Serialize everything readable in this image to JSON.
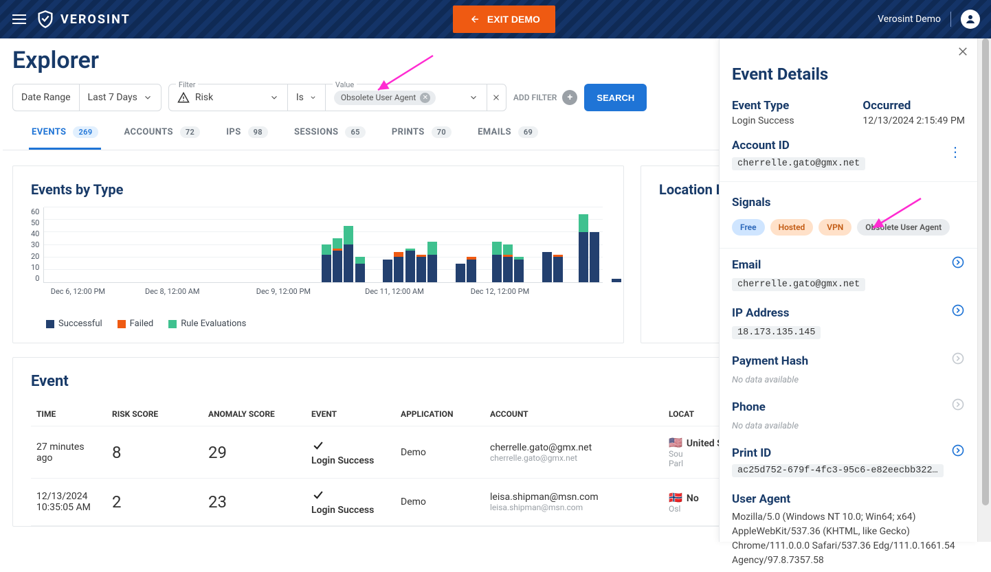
{
  "header": {
    "brand": "VEROSINT",
    "exit_demo_label": "EXIT DEMO",
    "account_label": "Verosint Demo"
  },
  "page_title": "Explorer",
  "filters": {
    "date_range_label": "Date Range",
    "date_range_value": "Last 7 Days",
    "filter_label": "Filter",
    "filter_value": "Risk",
    "operator_label": "Is",
    "value_label": "Value",
    "value_chip": "Obsolete User Agent",
    "add_filter_label": "ADD FILTER",
    "search_label": "SEARCH"
  },
  "tabs": [
    {
      "label": "EVENTS",
      "count": "269",
      "active": true
    },
    {
      "label": "ACCOUNTS",
      "count": "72",
      "active": false
    },
    {
      "label": "IPS",
      "count": "98",
      "active": false
    },
    {
      "label": "SESSIONS",
      "count": "65",
      "active": false
    },
    {
      "label": "PRINTS",
      "count": "70",
      "active": false
    },
    {
      "label": "EMAILS",
      "count": "69",
      "active": false
    }
  ],
  "events_by_type_title": "Events by Type",
  "location_card_title_partial": "Location B",
  "legend": {
    "successful": "Successful",
    "failed": "Failed",
    "rule": "Rule Evaluations"
  },
  "chart_data": {
    "type": "bar",
    "ylim": [
      0,
      60
    ],
    "y_ticks": [
      0,
      10,
      20,
      30,
      40,
      50,
      60
    ],
    "ylabel": "",
    "x_ticks": [
      {
        "pos": 0.05,
        "label": "Dec 6, 12:00 PM"
      },
      {
        "pos": 0.22,
        "label": "Dec 8, 12:00 AM"
      },
      {
        "pos": 0.42,
        "label": "Dec 9, 12:00 PM"
      },
      {
        "pos": 0.62,
        "label": "Dec 11, 12:00 AM"
      },
      {
        "pos": 0.81,
        "label": "Dec 12, 12:00 PM"
      }
    ],
    "series_names": [
      "Successful",
      "Failed",
      "Rule Evaluations"
    ],
    "bars": [
      {
        "x": 0.505,
        "values": [
          22,
          0,
          8
        ]
      },
      {
        "x": 0.525,
        "values": [
          25,
          2,
          8
        ]
      },
      {
        "x": 0.545,
        "values": [
          30,
          0,
          15
        ]
      },
      {
        "x": 0.565,
        "values": [
          15,
          0,
          5
        ]
      },
      {
        "x": 0.615,
        "values": [
          18,
          0,
          0
        ]
      },
      {
        "x": 0.635,
        "values": [
          20,
          4,
          0
        ]
      },
      {
        "x": 0.655,
        "values": [
          25,
          0,
          2
        ]
      },
      {
        "x": 0.675,
        "values": [
          20,
          2,
          0
        ]
      },
      {
        "x": 0.695,
        "values": [
          22,
          0,
          10
        ]
      },
      {
        "x": 0.745,
        "values": [
          15,
          0,
          0
        ]
      },
      {
        "x": 0.765,
        "values": [
          18,
          2,
          0
        ]
      },
      {
        "x": 0.81,
        "values": [
          22,
          0,
          10
        ]
      },
      {
        "x": 0.83,
        "values": [
          20,
          2,
          8
        ]
      },
      {
        "x": 0.85,
        "values": [
          18,
          0,
          2
        ]
      },
      {
        "x": 0.9,
        "values": [
          24,
          0,
          0
        ]
      },
      {
        "x": 0.92,
        "values": [
          20,
          2,
          0
        ]
      },
      {
        "x": 0.965,
        "values": [
          40,
          0,
          14
        ]
      },
      {
        "x": 0.985,
        "values": [
          40,
          0,
          0
        ]
      },
      {
        "x": 1.025,
        "values": [
          3,
          0,
          0
        ]
      }
    ]
  },
  "event_table": {
    "title": "Event",
    "columns": [
      "TIME",
      "RISK SCORE",
      "ANOMALY SCORE",
      "EVENT",
      "APPLICATION",
      "ACCOUNT",
      "LOCAT"
    ],
    "rows": [
      {
        "time_main": "27 minutes ago",
        "time_sub": "",
        "risk": "8",
        "anomaly": "29",
        "event": "Login Success",
        "icon": "check",
        "application": "Demo",
        "account_main": "cherrelle.gato@gmx.net",
        "account_sub": "cherrelle.gato@gmx.net",
        "location_flag": "🇺🇸",
        "location_main": "United Sta",
        "location_sub1": "Sou",
        "location_sub2": "Parl"
      },
      {
        "time_main": "12/13/2024",
        "time_sub": "10:35:05 AM",
        "risk": "2",
        "anomaly": "23",
        "event": "Login Success",
        "icon": "check",
        "application": "Demo",
        "account_main": "leisa.shipman@msn.com",
        "account_sub": "leisa.shipman@msn.com",
        "location_flag": "🇳🇴",
        "location_main": "No",
        "location_sub1": "Osl",
        "location_sub2": ""
      }
    ]
  },
  "drawer": {
    "title": "Event Details",
    "event_type_label": "Event Type",
    "event_type_value": "Login Success",
    "occurred_label": "Occurred",
    "occurred_value": "12/13/2024 2:15:49 PM",
    "account_id_label": "Account ID",
    "account_id_value": "cherrelle.gato@gmx.net",
    "signals_label": "Signals",
    "signals": [
      {
        "label": "Free",
        "style": "sp-blue"
      },
      {
        "label": "Hosted",
        "style": "sp-orange"
      },
      {
        "label": "VPN",
        "style": "sp-orange"
      },
      {
        "label": "Obsolete User Agent",
        "style": "sp-gray"
      }
    ],
    "fields": {
      "email_label": "Email",
      "email_value": "cherrelle.gato@gmx.net",
      "ip_label": "IP Address",
      "ip_value": "18.173.135.145",
      "payment_label": "Payment Hash",
      "payment_value": "No data available",
      "phone_label": "Phone",
      "phone_value": "No data available",
      "print_label": "Print ID",
      "print_value": "ac25d752-679f-4fc3-95c6-e82eecbb322…",
      "ua_label": "User Agent",
      "ua_value": "Mozilla/5.0 (Windows NT 10.0; Win64; x64) AppleWebKit/537.36 (KHTML, like Gecko) Chrome/111.0.0.0 Safari/537.36 Edg/111.0.1661.54 Agency/97.8.7357.58"
    }
  }
}
